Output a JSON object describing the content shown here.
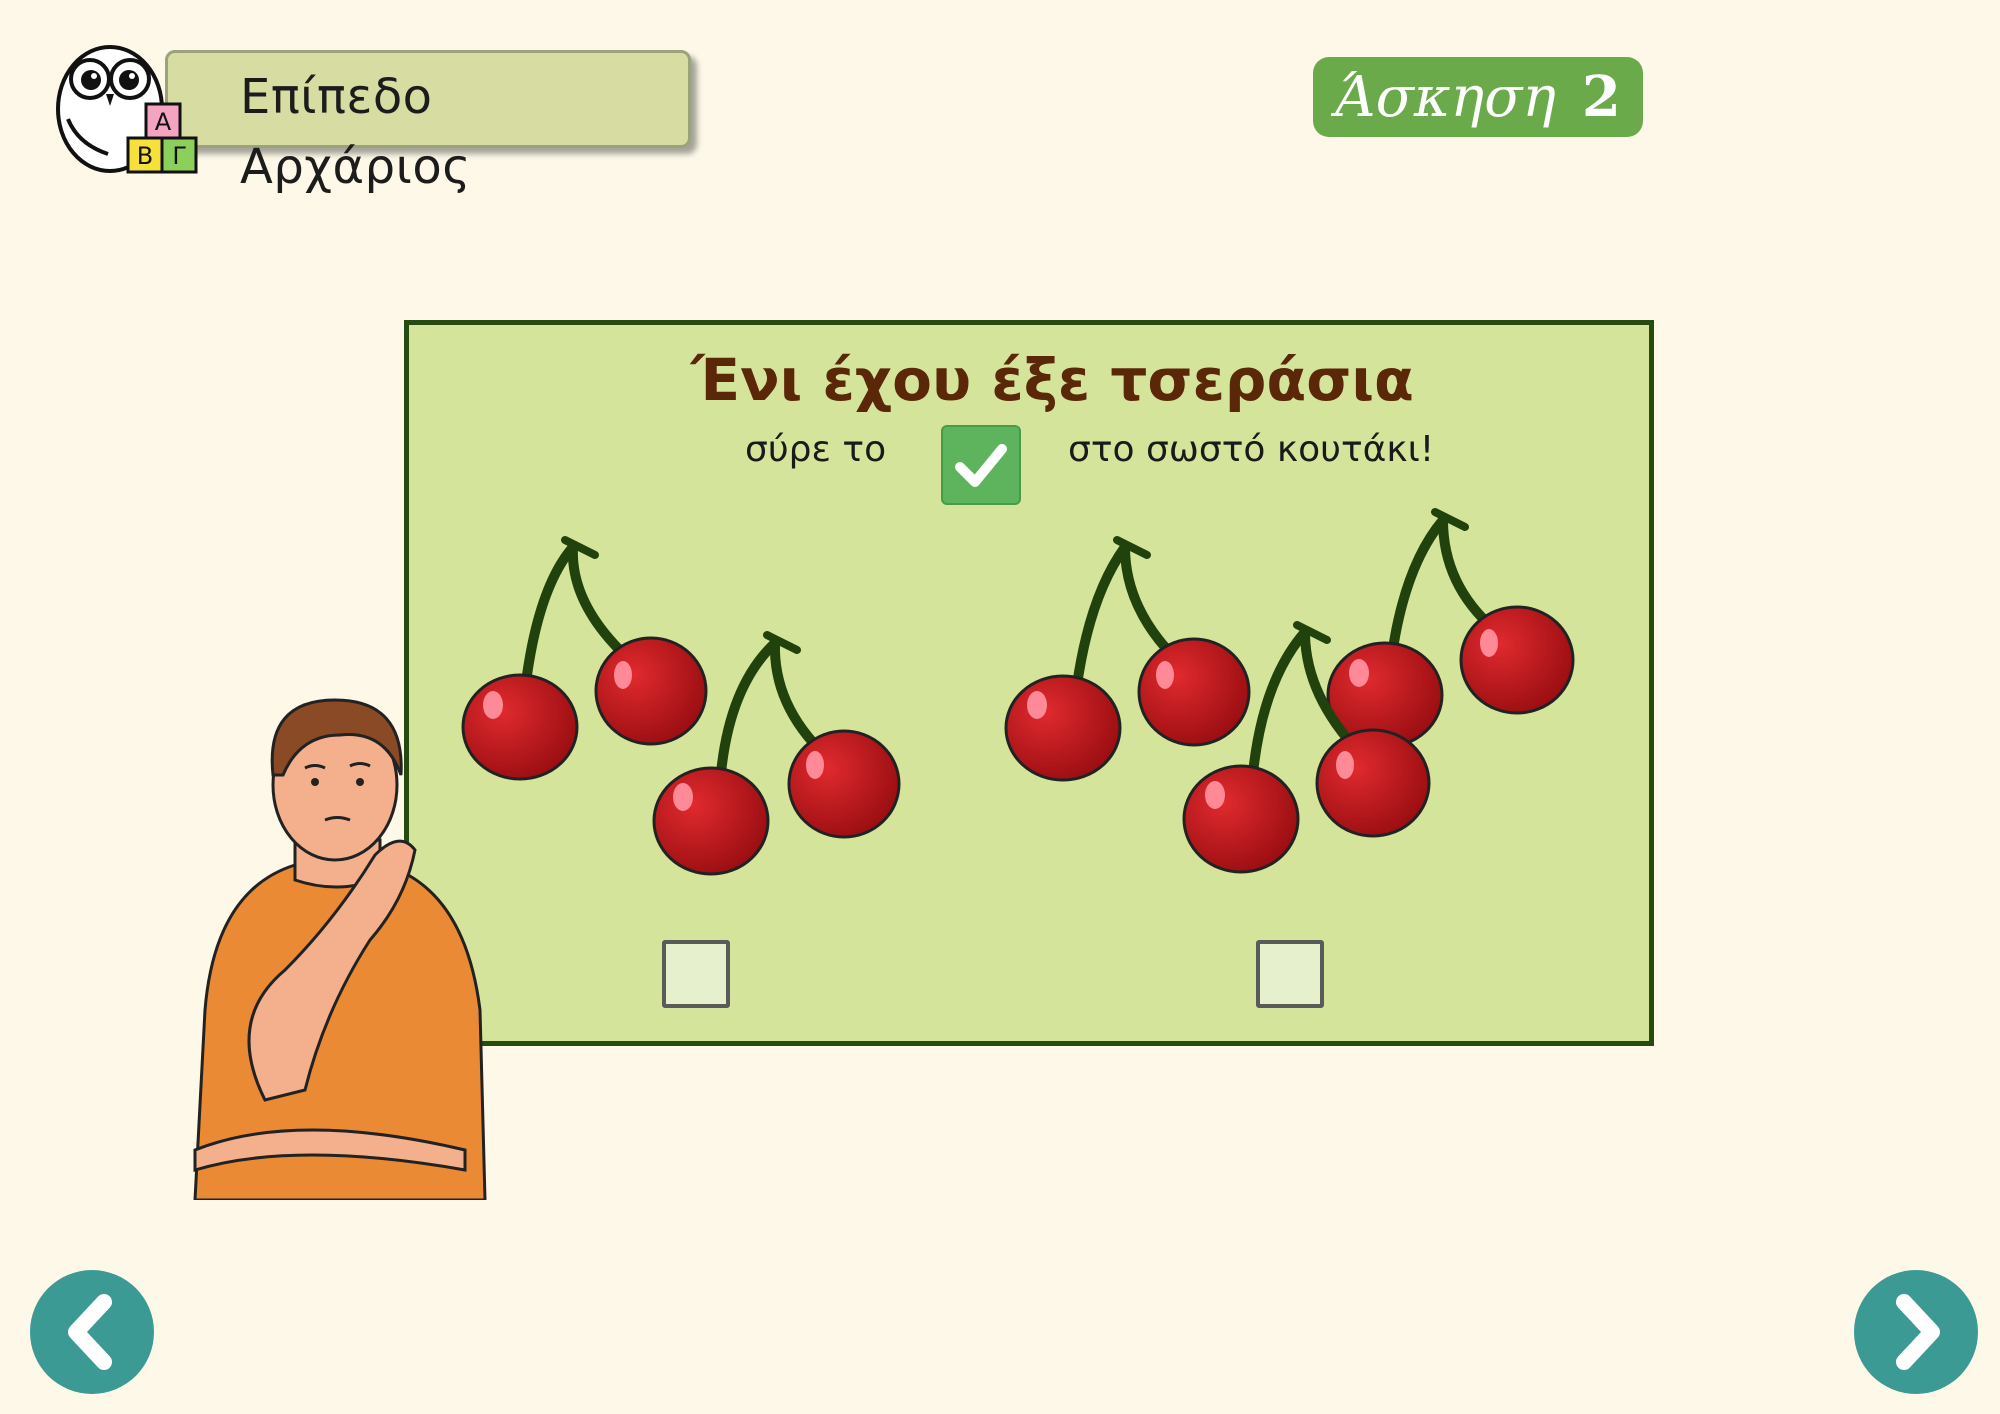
{
  "header": {
    "level_label": "Επίπεδο Αρχάριος",
    "logo_blocks": [
      "Α",
      "Β",
      "Γ"
    ]
  },
  "exercise": {
    "label": "Άσκηση",
    "number": "2"
  },
  "question": {
    "title": "Ένι έχου έξε τσεράσια",
    "instruction_before": "σύρε το",
    "instruction_after": "στο σωστό κουτάκι!"
  },
  "options": [
    {
      "name": "left-group",
      "cherry_count": 4
    },
    {
      "name": "right-group",
      "cherry_count": 6
    }
  ],
  "colors": {
    "background": "#fdf8e8",
    "panel": "#d4e59b",
    "panel_border": "#264a0f",
    "title": "#5a2709",
    "exercise_badge": "#6aaa4a",
    "check": "#5eb35d",
    "nav": "#3c9a95",
    "cherry": "#c4161c"
  },
  "icons": {
    "drag_item": "check-icon",
    "back": "chevron-left-icon",
    "next": "chevron-right-icon"
  }
}
